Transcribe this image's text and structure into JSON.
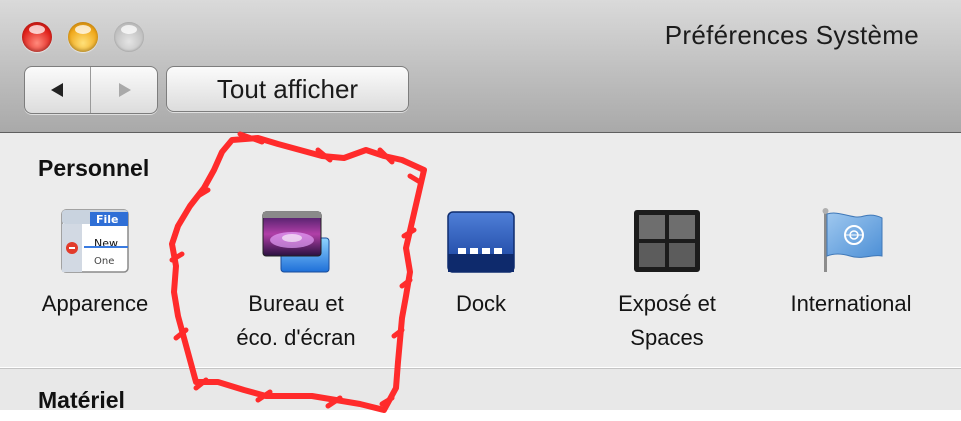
{
  "window": {
    "title": "Préférences Système",
    "traffic_lights": [
      "close",
      "minimize",
      "zoom"
    ]
  },
  "toolbar": {
    "back_icon": "back-arrow-icon",
    "forward_icon": "forward-arrow-icon",
    "show_all_label": "Tout afficher"
  },
  "sections": {
    "personal": {
      "title": "Personnel",
      "panes": [
        {
          "label": "Apparence",
          "icon": "appearance-icon"
        },
        {
          "label": "Bureau et\néco. d'écran",
          "icon": "desktop-screensaver-icon"
        },
        {
          "label": "Dock",
          "icon": "dock-icon"
        },
        {
          "label": "Exposé et\nSpaces",
          "icon": "expose-spaces-icon"
        },
        {
          "label": "International",
          "icon": "international-flag-icon"
        }
      ],
      "appearance_icon_text": [
        "File",
        "New",
        "One"
      ]
    },
    "hardware": {
      "title": "Matériel"
    }
  },
  "annotation": {
    "color": "#ff2b2b",
    "target": "Bureau et éco. d'écran"
  }
}
